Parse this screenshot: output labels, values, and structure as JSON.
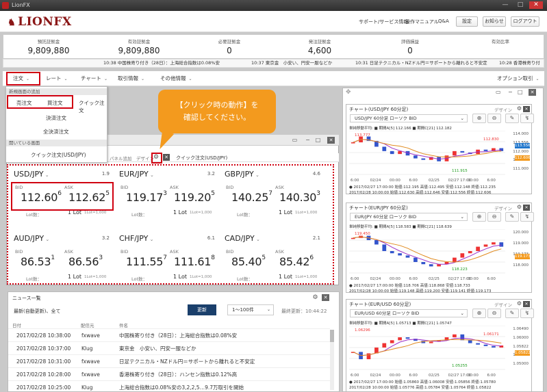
{
  "window": {
    "title": "LionFX",
    "min": "—",
    "max": "□",
    "close": "✕"
  },
  "header": {
    "logo": "LIONFX",
    "links": [
      "サポート/サービス情報",
      "操作マニュアル",
      "Q&A"
    ],
    "buttons": [
      "設定",
      "お知らせ",
      "ログアウト"
    ]
  },
  "summary": [
    {
      "label": "預託証拠金",
      "value": "9,809,880"
    },
    {
      "label": "有効証拠金",
      "value": "9,809,880"
    },
    {
      "label": "必要証拠金",
      "value": "0"
    },
    {
      "label": "発注証拠金",
      "value": "4,600"
    },
    {
      "label": "評価損益",
      "value": "0"
    },
    {
      "label": "有効比率",
      "value": ""
    }
  ],
  "ticker": [
    "10:38 中国株寄り付き（28日）：上海総合指数は0.08%安",
    "10:37 東京金　小安い、円安一服などか",
    "10:31 日足テクニカル・NZドル円＝サポートから離れると不安定",
    "10:28 香港株寄り付"
  ],
  "menu": {
    "items": [
      "注文",
      "レート",
      "チャート",
      "取引情報",
      "その他情報"
    ],
    "right": "オプション取引"
  },
  "dropdown": {
    "section1": "新規画面の追加",
    "items1": [
      "売注文",
      "買注文",
      "クイック注文"
    ],
    "items2": [
      "決済注文",
      "全決済注文"
    ],
    "section2": "開いている画面",
    "items3": [
      "クイック注文(USD/JPY)"
    ]
  },
  "callout": {
    "line1": "【クリック時の動作】を",
    "line2": "確認してください。"
  },
  "quick_panel": {
    "tab1": "パネル追加",
    "tab2": "デザイン",
    "title": "クイック注文(USD/JPY)"
  },
  "quick": [
    {
      "pair": "USD/JPY",
      "spread": "1.9",
      "bid_main": "112.60",
      "bid_pip": "6",
      "ask_main": "112.62",
      "ask_pip": "5"
    },
    {
      "pair": "EUR/JPY",
      "spread": "3.2",
      "bid_main": "119.17",
      "bid_pip": "3",
      "ask_main": "119.20",
      "ask_pip": "5"
    },
    {
      "pair": "GBP/JPY",
      "spread": "4.6",
      "bid_main": "140.25",
      "bid_pip": "7",
      "ask_main": "140.30",
      "ask_pip": "3"
    },
    {
      "pair": "AUD/JPY",
      "spread": "3.2",
      "bid_main": "86.53",
      "bid_pip": "1",
      "ask_main": "86.56",
      "ask_pip": "3"
    },
    {
      "pair": "CHF/JPY",
      "spread": "6.1",
      "bid_main": "111.55",
      "bid_pip": "7",
      "ask_main": "111.61",
      "ask_pip": "8"
    },
    {
      "pair": "CAD/JPY",
      "spread": "2.1",
      "bid_main": "85.40",
      "bid_pip": "5",
      "ask_main": "85.42",
      "ask_pip": "6"
    }
  ],
  "quick_labels": {
    "bid": "BID",
    "ask": "ASK",
    "lot_label": "Lot数：",
    "lot_value": "1 Lot",
    "lot_unit": "1Lot=1,000"
  },
  "news": {
    "title": "ニュース一覧",
    "filter": "最新(自動更新)、全て",
    "update_btn": "更新",
    "range": "1〜100件",
    "last_update": "最終更新：10:44:22",
    "cols": [
      "日付",
      "配信元",
      "件名"
    ],
    "rows": [
      [
        "2017/02/28 10:38:00",
        "fxwave",
        "中国株寄り付き（28日）：上海総合指数は0.08%安"
      ],
      [
        "2017/02/28 10:37:00",
        "Klug",
        "東京金　小安い、円安一服などか"
      ],
      [
        "2017/02/28 10:31:00",
        "fxwave",
        "日足テクニカル・NZドル円＝サポートから離れると不安定"
      ],
      [
        "2017/02/28 10:28:00",
        "fxwave",
        "香港株寄り付き（28日）：ハンセン指数は0.12%高"
      ],
      [
        "2017/02/28 10:25:00",
        "Klug",
        "上海総合指数は0.08%安の3,2,2,5…9.7万取引を開始"
      ]
    ]
  },
  "charts": [
    {
      "title": "チャート(USD/JPY 60分足)",
      "design": "デザイン",
      "selector": "USD/JPY 60分足 ローソク BID",
      "legend": "単純移動平均:  ■ 期間A[5] 112.166  ■ 期間C[21] 112.182",
      "xticks": [
        "6:00",
        "02/24",
        "00:00",
        "6:00",
        "02/25",
        "02/27 17:00",
        "00:00",
        "6:00"
      ],
      "yticks": [
        "114.000",
        "113.556",
        "112.000",
        "112.606",
        "111.000"
      ],
      "hi": "113.777",
      "lo": "111.915",
      "foot1": "● 2017/02/27 17:00:00  始値:112.195 高値:112.495 安値:112.148 終値:112.235",
      "foot2": "2017/02/28 10:00:00  始値:112.630 高値:112.646 安値:112.556 終値:112.606",
      "tag_high": "113.556",
      "tag_last": "112.606",
      "mark": "112.830",
      "chart_data": {
        "type": "candlestick",
        "series": [
          {
            "name": "期間A[5]",
            "value": 112.166
          },
          {
            "name": "期間C[21]",
            "value": 112.182
          }
        ],
        "ylim": [
          111.0,
          114.0
        ],
        "close": [
          113.2,
          113.6,
          113.3,
          112.9,
          112.6,
          112.4,
          112.6,
          112.3,
          112.1,
          112.0,
          112.2,
          111.9,
          112.3,
          112.6,
          112.5,
          112.4,
          112.7,
          112.6,
          112.8,
          112.6
        ]
      }
    },
    {
      "title": "チャート(EUR/JPY 60分足)",
      "design": "デザイン",
      "selector": "EUR/JPY 60分足 ローソク BID",
      "legend": "単純移動平均:  ■ 期間A[5] 118.583  ■ 期間C[21] 118.639",
      "xticks": [
        "6:00",
        "02/24",
        "00:00",
        "6:00",
        "02/25",
        "02/27 17:00",
        "00:00",
        "6:00"
      ],
      "yticks": [
        "120.000",
        "119.000",
        "119.173",
        "118.000"
      ],
      "hi": "119.450",
      "lo": "118.223",
      "foot1": "● 2017/02/27 17:00:00  始値:118.706 高値:118.868 安値:118.733",
      "foot2": "2017/02/28 10:00:00  始値:119.148 高値:119.200 安値:119.141 終値:119.173",
      "tag_high": "",
      "tag_last": "119.173",
      "mark": "",
      "chart_data": {
        "type": "candlestick",
        "series": [
          {
            "name": "期間A[5]",
            "value": 118.583
          },
          {
            "name": "期間C[21]",
            "value": 118.639
          }
        ],
        "ylim": [
          118.0,
          120.0
        ],
        "close": [
          119.6,
          119.7,
          119.5,
          119.3,
          119.0,
          118.9,
          118.8,
          118.7,
          118.5,
          118.4,
          118.3,
          118.4,
          118.5,
          118.7,
          118.9,
          119.0,
          119.2,
          119.3,
          119.4,
          119.2
        ]
      }
    },
    {
      "title": "チャート(EUR/USD 60分足)",
      "design": "デザイン",
      "selector": "EUR/USD 60分足 ローソク BID",
      "legend": "単純移動平均:  ■ 期間A[5] 1.05713  ■ 期間C[21] 1.05747",
      "xticks": [
        "6:00",
        "02/24",
        "00:00",
        "6:00",
        "02/25",
        "02/27 17:00",
        "00:00",
        "6:00"
      ],
      "yticks": [
        "1.06490",
        "1.06000",
        "1.05822",
        "1.05500",
        "1.05000"
      ],
      "hi": "1.06296",
      "lo": "1.05255",
      "foot1": "● 2017/02/27 17:00:00  始値:1.05860 高値:1.06008 安値:1.05856 終値:1.05780",
      "foot2": "2017/02/28 10:00:00  始値:1.05776 高値:1.05784 安値:1.05764 終値:1.05822",
      "tag_high": "",
      "tag_last": "1.05822",
      "mark": "1.06171",
      "chart_data": {
        "type": "candlestick",
        "series": [
          {
            "name": "期間A[5]",
            "value": 1.05713
          },
          {
            "name": "期間C[21]",
            "value": 1.05747
          }
        ],
        "ylim": [
          1.05,
          1.065
        ],
        "close": [
          1.056,
          1.0535,
          1.0555,
          1.0575,
          1.059,
          1.06,
          1.061,
          1.0605,
          1.0598,
          1.059,
          1.0595,
          1.06,
          1.061,
          1.062,
          1.06,
          1.059,
          1.0585,
          1.058,
          1.0575,
          1.0582
        ]
      }
    }
  ]
}
